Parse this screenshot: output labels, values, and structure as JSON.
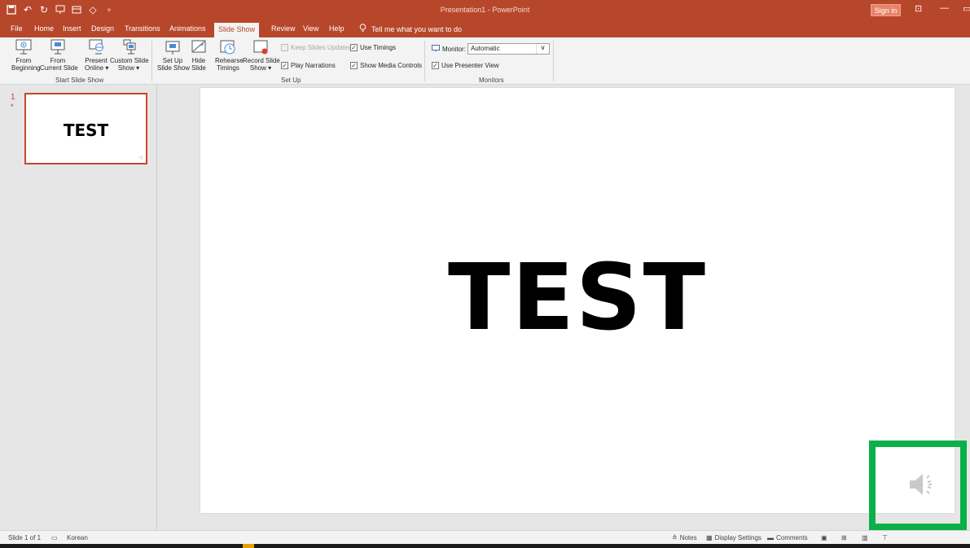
{
  "window": {
    "title": "Presentation1 - PowerPoint",
    "sign_in": "Sign in"
  },
  "tabs": [
    {
      "label": "File"
    },
    {
      "label": "Home"
    },
    {
      "label": "Insert"
    },
    {
      "label": "Design"
    },
    {
      "label": "Transitions"
    },
    {
      "label": "Animations"
    },
    {
      "label": "Slide Show",
      "active": true
    },
    {
      "label": "Review"
    },
    {
      "label": "View"
    },
    {
      "label": "Help"
    }
  ],
  "tell_me": "Tell me what you want to do",
  "ribbon": {
    "start": {
      "from_beginning": "From\nBeginning",
      "from_current": "From\nCurrent Slide",
      "present_online": "Present\nOnline ▾",
      "custom_show": "Custom Slide\nShow ▾",
      "label": "Start Slide Show"
    },
    "setup": {
      "setup_show": "Set Up\nSlide Show",
      "hide_slide": "Hide\nSlide",
      "rehearse": "Rehearse\nTimings",
      "record": "Record Slide\nShow ▾",
      "keep_updated": "Keep Slides Updated",
      "use_timings": "Use Timings",
      "play_narrations": "Play Narrations",
      "show_media": "Show Media Controls",
      "label": "Set Up"
    },
    "monitors": {
      "monitor_label": "Monitor:",
      "monitor_value": "Automatic",
      "presenter_view": "Use Presenter View",
      "label": "Monitors"
    }
  },
  "thumbnails": [
    {
      "number": "1",
      "text": "TEST"
    }
  ],
  "slide": {
    "text": "TEST"
  },
  "status": {
    "slide_count": "Slide 1 of 1",
    "language": "Korean",
    "notes": "Notes",
    "display_settings": "Display Settings",
    "comments": "Comments"
  },
  "colors": {
    "accent": "#b7472a",
    "highlight": "#0bb04a"
  }
}
